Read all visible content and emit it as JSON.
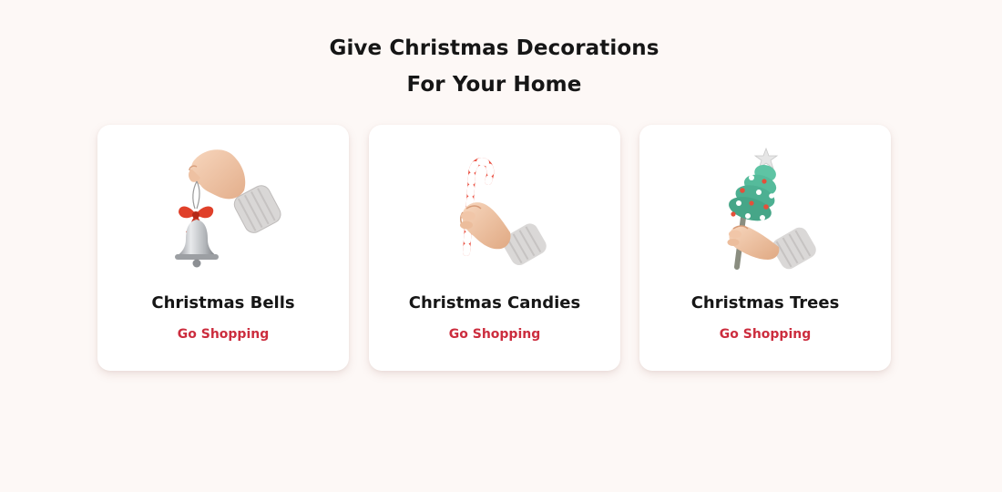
{
  "section": {
    "heading_line1": "Give Christmas Decorations",
    "heading_line2": "For Your Home"
  },
  "cards": [
    {
      "title": "Christmas Bells",
      "link_label": "Go Shopping",
      "icon": "bell-in-hand-icon"
    },
    {
      "title": "Christmas Candies",
      "link_label": "Go Shopping",
      "icon": "candy-cane-in-hand-icon"
    },
    {
      "title": "Christmas Trees",
      "link_label": "Go Shopping",
      "icon": "tree-in-hand-icon"
    }
  ],
  "colors": {
    "background": "#fdf8f6",
    "card": "#ffffff",
    "text": "#161616",
    "accent": "#cc2d3e"
  }
}
